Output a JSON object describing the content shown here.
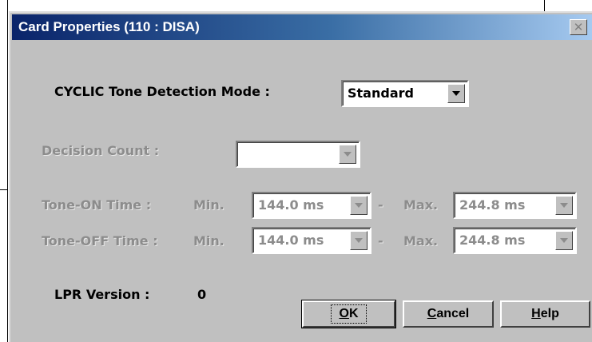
{
  "dialog": {
    "title": "Card Properties (110 : DISA)",
    "close_glyph": "✕"
  },
  "tone_mode": {
    "label": "CYCLIC Tone Detection Mode :",
    "value": "Standard"
  },
  "decision_count": {
    "label": "Decision Count :",
    "value": ""
  },
  "tone_on": {
    "label": "Tone-ON  Time :",
    "min_label": "Min.",
    "min_value": "144.0 ms",
    "dash": "-",
    "max_label": "Max.",
    "max_value": "244.8 ms"
  },
  "tone_off": {
    "label": "Tone-OFF Time :",
    "min_label": "Min.",
    "min_value": "144.0 ms",
    "dash": "-",
    "max_label": "Max.",
    "max_value": "244.8 ms"
  },
  "lpr": {
    "label": "LPR Version :",
    "value": "0"
  },
  "buttons": {
    "ok_mnemonic": "O",
    "ok_rest": "K",
    "cancel_mnemonic": "C",
    "cancel_rest": "ancel",
    "help_mnemonic": "H",
    "help_rest": "elp"
  },
  "icons": {
    "dropdown": "chevron-down-icon",
    "close": "close-icon"
  }
}
